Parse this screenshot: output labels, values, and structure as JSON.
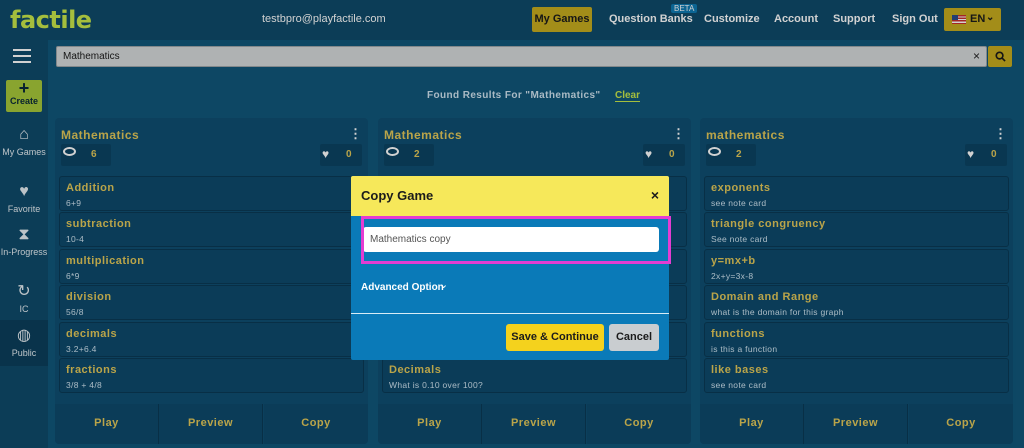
{
  "app": {
    "logo": "factile",
    "user_email": "testbpro@playfactile.com"
  },
  "nav": {
    "items": [
      {
        "label": "My Games",
        "active": true
      },
      {
        "label": "Question Banks",
        "badge": "BETA"
      },
      {
        "label": "Customize"
      },
      {
        "label": "Account"
      },
      {
        "label": "Support"
      },
      {
        "label": "Sign Out"
      }
    ],
    "language": {
      "label": "EN",
      "flag": "us-flag-icon"
    }
  },
  "sidebar": {
    "create_label": "Create",
    "items": [
      {
        "label": "My Games",
        "icon": "home-icon"
      },
      {
        "label": "Favorite",
        "icon": "heart-icon"
      },
      {
        "label": "In-Progress",
        "icon": "hourglass-icon"
      },
      {
        "label": "IC",
        "icon": "ic-icon"
      },
      {
        "label": "Public",
        "icon": "globe-icon",
        "active": true
      }
    ]
  },
  "search": {
    "value": "Mathematics",
    "clear_icon": "×",
    "search_icon": "search-icon"
  },
  "results": {
    "found_text": "Found Results For \"Mathematics\"",
    "clear_label": "Clear"
  },
  "cards": [
    {
      "title": "Mathematics",
      "views": "6",
      "likes": "0",
      "categories": [
        {
          "name": "Addition",
          "sub": "6+9"
        },
        {
          "name": "subtraction",
          "sub": "10-4"
        },
        {
          "name": "multiplication",
          "sub": "6*9"
        },
        {
          "name": "division",
          "sub": "56/8"
        },
        {
          "name": "decimals",
          "sub": "3.2+6.4"
        },
        {
          "name": "fractions",
          "sub": "3/8 + 4/8"
        }
      ],
      "actions": [
        "Play",
        "Preview",
        "Copy"
      ]
    },
    {
      "title": "Mathematics",
      "views": "2",
      "likes": "0",
      "categories": [
        {
          "name": "Decimals",
          "sub": "What is 0.10 over 100?"
        }
      ],
      "actions": [
        "Play",
        "Preview",
        "Copy"
      ]
    },
    {
      "title": "mathematics",
      "views": "2",
      "likes": "0",
      "categories": [
        {
          "name": "exponents",
          "sub": "see note card"
        },
        {
          "name": "triangle congruency",
          "sub": "See note card"
        },
        {
          "name": "y=mx+b",
          "sub": "2x+y=3x-8"
        },
        {
          "name": "Domain and Range",
          "sub": "what is the domain for this graph"
        },
        {
          "name": "functions",
          "sub": "is this a function"
        },
        {
          "name": "like bases",
          "sub": "see note card"
        }
      ],
      "actions": [
        "Play",
        "Preview",
        "Copy"
      ]
    }
  ],
  "modal": {
    "title": "Copy Game",
    "close_icon": "×",
    "name_value": "Mathematics copy",
    "advanced_label": "Advanced Option",
    "save_label": "Save & Continue",
    "cancel_label": "Cancel"
  },
  "colors": {
    "accent": "#c7ac1f",
    "modal_header": "#f6e85a",
    "highlight": "#e43cd2",
    "modal_body": "#0a7ab8"
  }
}
